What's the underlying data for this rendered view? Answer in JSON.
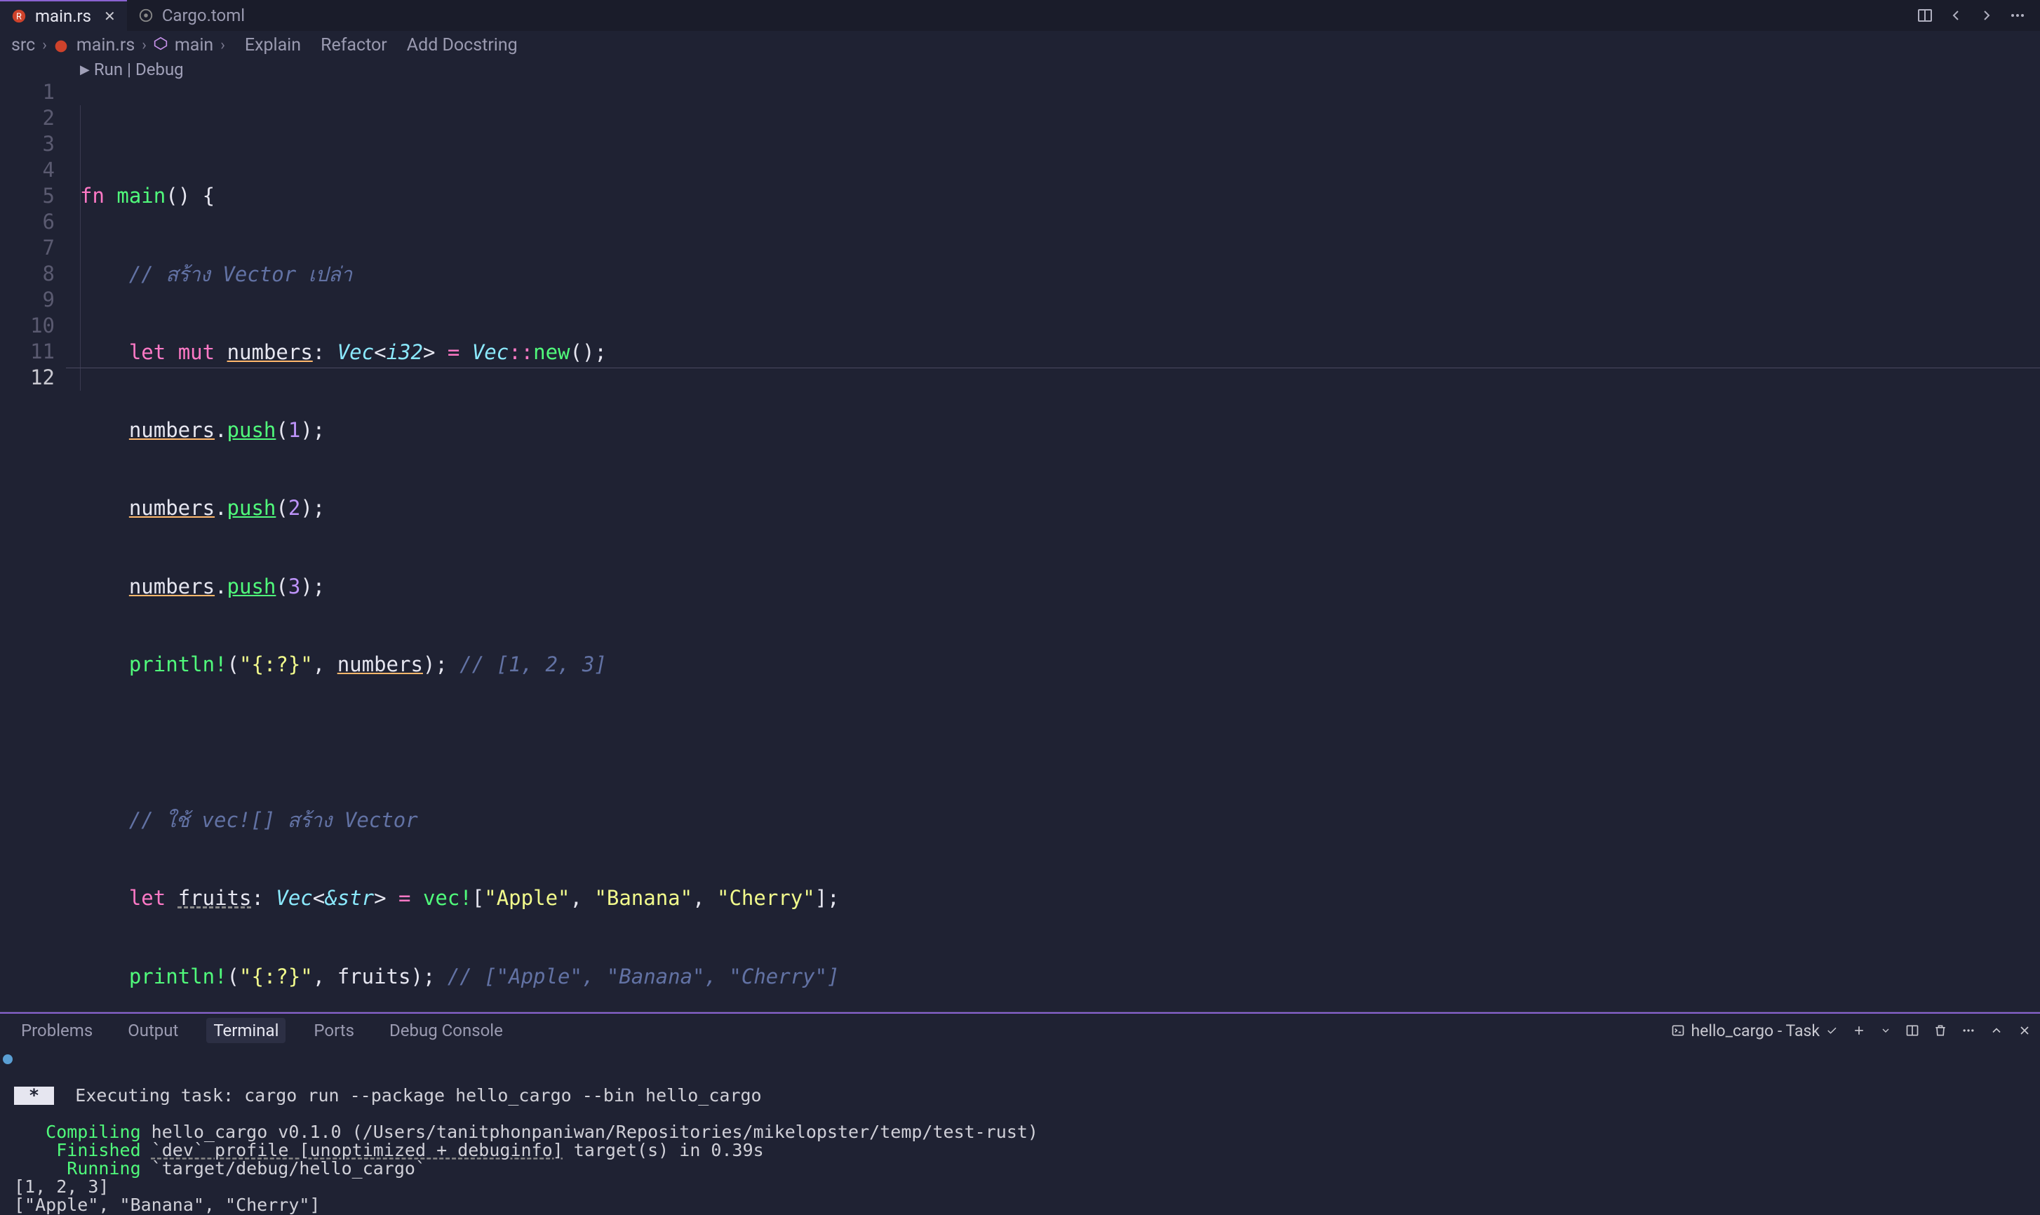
{
  "tabs": {
    "active": {
      "label": "main.rs",
      "icon": "rust-icon"
    },
    "inactive": {
      "label": "Cargo.toml",
      "icon": "gear-icon"
    }
  },
  "titlebar_icons": [
    "split-icon",
    "back-icon",
    "forward-icon",
    "more-icon"
  ],
  "breadcrumb": {
    "seg0": "src",
    "seg1": "main.rs",
    "seg2": "main",
    "actions": {
      "explain": "Explain",
      "refactor": "Refactor",
      "docstring": "Add Docstring"
    }
  },
  "codelens": {
    "run": "Run",
    "sep": "|",
    "debug": "Debug"
  },
  "editor": {
    "line_numbers": [
      "1",
      "2",
      "3",
      "4",
      "5",
      "6",
      "7",
      "8",
      "9",
      "10",
      "11",
      "12"
    ],
    "code": {
      "l1_fn": "fn",
      "l1_name": "main",
      "l1_rest": "() {",
      "l2": "// สร้าง Vector เปล่า",
      "l3_let": "let",
      "l3_mut": "mut",
      "l3_name": "numbers",
      "l3_type": "Vec",
      "l3_i32": "i32",
      "l3_vec2": "Vec",
      "l3_new": "new",
      "l4_name": "numbers",
      "l4_push": "push",
      "l4_arg": "1",
      "l5_name": "numbers",
      "l5_push": "push",
      "l5_arg": "2",
      "l6_name": "numbers",
      "l6_push": "push",
      "l6_arg": "3",
      "l7_mac": "println!",
      "l7_fmt": "\"{:?}\"",
      "l7_arg": "numbers",
      "l7_cmt": "// [1, 2, 3]",
      "l9": "// ใช้ vec![] สร้าง Vector",
      "l10_let": "let",
      "l10_name": "fruits",
      "l10_type": "Vec",
      "l10_str": "&str",
      "l10_vecmac": "vec!",
      "l10_a": "\"Apple\"",
      "l10_b": "\"Banana\"",
      "l10_c": "\"Cherry\"",
      "l11_mac": "println!",
      "l11_fmt": "\"{:?}\"",
      "l11_arg": "fruits",
      "l11_cmt": "// [\"Apple\", \"Banana\", \"Cherry\"]",
      "l12": "}"
    }
  },
  "panel": {
    "tabs": {
      "problems": "Problems",
      "output": "Output",
      "terminal": "Terminal",
      "ports": "Ports",
      "debug": "Debug Console"
    },
    "right": {
      "task": "hello_cargo - Task"
    }
  },
  "terminal": {
    "exec": "Executing task: cargo run --package hello_cargo --bin hello_cargo",
    "compiling_lbl": "Compiling",
    "compiling_rest": " hello_cargo v0.1.0 (/Users/tanitphonpaniwan/Repositories/mikelopster/temp/test-rust)",
    "finished_lbl": "Finished",
    "finished_link": "`dev` profile [unoptimized + debuginfo]",
    "finished_rest": " target(s) in 0.39s",
    "running_lbl": "Running",
    "running_rest": " `target/debug/hello_cargo`",
    "out1": "[1, 2, 3]",
    "out2": "[\"Apple\", \"Banana\", \"Cherry\"]"
  }
}
